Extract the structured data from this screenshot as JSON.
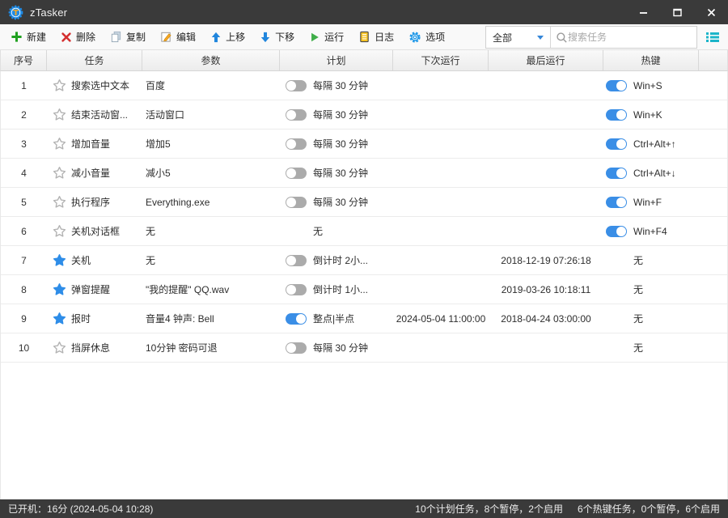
{
  "window": {
    "title": "zTasker"
  },
  "toolbar": {
    "buttons": [
      {
        "label": "新建"
      },
      {
        "label": "删除"
      },
      {
        "label": "复制"
      },
      {
        "label": "编辑"
      },
      {
        "label": "上移"
      },
      {
        "label": "下移"
      },
      {
        "label": "运行"
      },
      {
        "label": "日志"
      },
      {
        "label": "选项"
      }
    ],
    "filter": {
      "value": "全部"
    },
    "search": {
      "placeholder": "搜索任务"
    }
  },
  "table": {
    "headers": [
      "序号",
      "任务",
      "参数",
      "计划",
      "下次运行",
      "最后运行",
      "热键"
    ],
    "rows": [
      {
        "num": "1",
        "starred": false,
        "task": "搜索选中文本",
        "params": "百度",
        "schedule_toggle": "off",
        "schedule": "每隔 30 分钟",
        "next_run": "",
        "last_run": "",
        "hotkey_toggle": "on",
        "hotkey": "Win+S"
      },
      {
        "num": "2",
        "starred": false,
        "task": "结束活动窗...",
        "params": "活动窗口",
        "schedule_toggle": "off",
        "schedule": "每隔 30 分钟",
        "next_run": "",
        "last_run": "",
        "hotkey_toggle": "on",
        "hotkey": "Win+K"
      },
      {
        "num": "3",
        "starred": false,
        "task": "增加音量",
        "params": "增加5",
        "schedule_toggle": "off",
        "schedule": "每隔 30 分钟",
        "next_run": "",
        "last_run": "",
        "hotkey_toggle": "on",
        "hotkey": "Ctrl+Alt+↑"
      },
      {
        "num": "4",
        "starred": false,
        "task": "减小音量",
        "params": "减小5",
        "schedule_toggle": "off",
        "schedule": "每隔 30 分钟",
        "next_run": "",
        "last_run": "",
        "hotkey_toggle": "on",
        "hotkey": "Ctrl+Alt+↓"
      },
      {
        "num": "5",
        "starred": false,
        "task": "执行程序",
        "params": "Everything.exe",
        "schedule_toggle": "off",
        "schedule": "每隔 30 分钟",
        "next_run": "",
        "last_run": "",
        "hotkey_toggle": "on",
        "hotkey": "Win+F"
      },
      {
        "num": "6",
        "starred": false,
        "task": "关机对话框",
        "params": "无",
        "schedule_toggle": null,
        "schedule": "无",
        "next_run": "",
        "last_run": "",
        "hotkey_toggle": "on",
        "hotkey": "Win+F4"
      },
      {
        "num": "7",
        "starred": true,
        "task": "关机",
        "params": "无",
        "schedule_toggle": "off",
        "schedule": "倒计时 2小...",
        "next_run": "",
        "last_run": "2018-12-19 07:26:18",
        "hotkey_toggle": null,
        "hotkey": "无"
      },
      {
        "num": "8",
        "starred": true,
        "task": "弹窗提醒",
        "params": "\"我的提醒\" QQ.wav",
        "schedule_toggle": "off",
        "schedule": "倒计时 1小...",
        "next_run": "",
        "last_run": "2019-03-26 10:18:11",
        "hotkey_toggle": null,
        "hotkey": "无"
      },
      {
        "num": "9",
        "starred": true,
        "task": "报时",
        "params": "音量4 钟声: Bell",
        "schedule_toggle": "on",
        "schedule": "整点|半点",
        "next_run": "2024-05-04 11:00:00",
        "last_run": "2018-04-24 03:00:00",
        "hotkey_toggle": null,
        "hotkey": "无"
      },
      {
        "num": "10",
        "starred": false,
        "task": "挡屏休息",
        "params": "10分钟 密码可退",
        "schedule_toggle": "off",
        "schedule": "每隔 30 分钟",
        "next_run": "",
        "last_run": "",
        "hotkey_toggle": null,
        "hotkey": "无"
      }
    ]
  },
  "status_bar": {
    "left": "已开机：16分 (2024-05-04 10:28)",
    "plan_summary": "10个计划任务，8个暂停，2个启用",
    "hotkey_summary": "6个热键任务，0个暂停，6个启用"
  },
  "colors": {
    "accent_blue": "#3a8ee6",
    "star_blue": "#2e8de8",
    "toggle_off_gray": "#ababab",
    "teal": "#1cb5c9",
    "green": "#21a121",
    "red": "#d43030",
    "titlebar": "#3a3a3a"
  }
}
